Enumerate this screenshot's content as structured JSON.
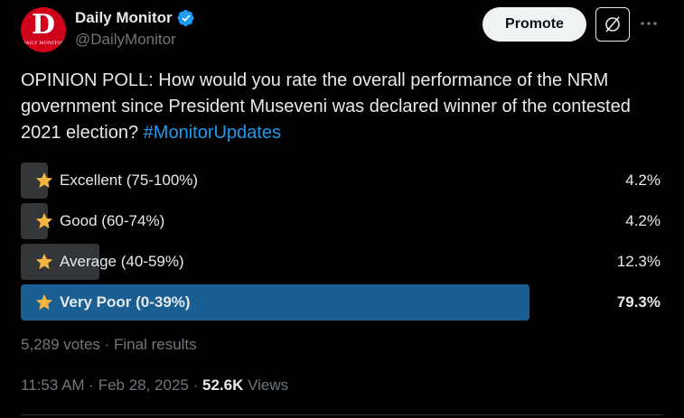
{
  "account": {
    "display_name": "Daily Monitor",
    "handle": "@DailyMonitor",
    "logo_letter": "D",
    "logo_subtext": "DAILY MONITOR",
    "verified": true
  },
  "actions": {
    "promote_label": "Promote"
  },
  "tweet": {
    "text": "OPINION POLL: How would you rate the overall performance of the NRM government since President Museveni was declared winner of the contested 2021 election? ",
    "hashtag": "#MonitorUpdates"
  },
  "poll": {
    "options": [
      {
        "label": "Excellent (75-100%)",
        "percent": "4.2%",
        "share": 0.042,
        "winner": false
      },
      {
        "label": "Good (60-74%)",
        "percent": "4.2%",
        "share": 0.042,
        "winner": false
      },
      {
        "label": "Average (40-59%)",
        "percent": "12.3%",
        "share": 0.123,
        "winner": false
      },
      {
        "label": "Very Poor (0-39%)",
        "percent": "79.3%",
        "share": 0.793,
        "winner": true
      }
    ],
    "votes_text": "5,289 votes",
    "separator": " · ",
    "status_text": "Final results"
  },
  "meta": {
    "time": "11:53 AM",
    "separator": " · ",
    "date": "Feb 28, 2025",
    "views_count": "52.6K",
    "views_label": " Views"
  },
  "colors": {
    "background": "#000000",
    "text": "#e7e9ea",
    "muted": "#71767b",
    "link": "#1d9bf0",
    "bar": "#333639",
    "bar_winner": "#1a5f94",
    "star": "#f4b63f",
    "brand_red": "#d0021b"
  },
  "icons": {
    "verified": "verified-badge-icon",
    "grok": "grok-icon",
    "more": "more-horizontal-icon",
    "option": "star-icon"
  }
}
